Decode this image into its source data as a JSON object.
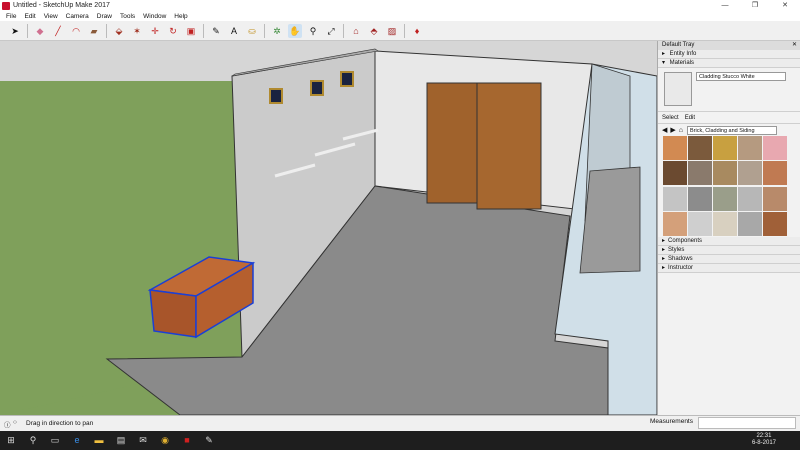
{
  "window": {
    "title": "Untitled - SketchUp Make 2017",
    "minimize": "—",
    "maximize": "❐",
    "close": "✕"
  },
  "menu": [
    "File",
    "Edit",
    "View",
    "Camera",
    "Draw",
    "Tools",
    "Window",
    "Help"
  ],
  "tray": {
    "title": "Default Tray",
    "sections": {
      "entity_info": "Entity Info",
      "materials": "Materials"
    },
    "material_name": "Cladding Stucco White",
    "tabs": {
      "select": "Select",
      "edit": "Edit"
    },
    "library": "Brick, Cladding and Siding",
    "collapsed": [
      "Components",
      "Styles",
      "Shadows",
      "Instructor"
    ]
  },
  "status": {
    "hint": "Drag in direction to pan",
    "measurements_label": "Measurements"
  },
  "clock": {
    "time": "22:31",
    "date": "6-8-2017"
  },
  "colors": {
    "sky": "#d6d6d6",
    "ground": "#7fa05b",
    "floor": "#8b8b8b",
    "wall": "#e6e6e6",
    "door": "#a0622c",
    "chest": "#b05a2a",
    "selection": "#1a3fd6"
  },
  "swatches": [
    "#d28a52",
    "#7b5a3c",
    "#c8a040",
    "#b59a80",
    "#e8a8b0",
    "#6b4a30",
    "#8a7a6c",
    "#a88a60",
    "#b0a090",
    "#c07a52",
    "#c4c4c4",
    "#8c8c8c",
    "#9a9e8a",
    "#b7b7b7",
    "#b88a6a",
    "#d4a07a",
    "#cfcfcf",
    "#d8d0c0",
    "#a8a8a8",
    "#a06038"
  ]
}
